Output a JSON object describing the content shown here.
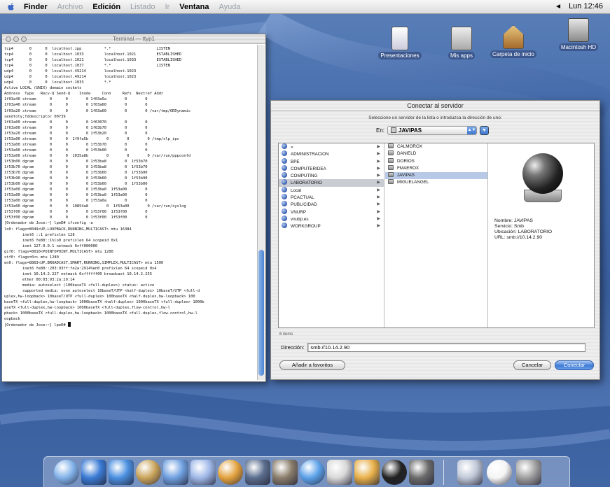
{
  "menubar": {
    "app": "Finder",
    "items": [
      "Archivo",
      "Edición",
      "Listado",
      "Ir",
      "Ventana",
      "Ayuda"
    ],
    "clock": "Lun 12:46"
  },
  "desktop_icons": [
    {
      "label": "Presentaciones",
      "icon": "document-icon"
    },
    {
      "label": "Mis apps",
      "icon": "app-folder-icon"
    },
    {
      "label": "Carpeta de inicio",
      "icon": "home-icon"
    },
    {
      "label": "Macintosh HD",
      "icon": "hard-disk-icon"
    }
  ],
  "terminal": {
    "title": "Terminal — ttyp1",
    "lines": [
      "tcp4       0      0  localhost.ipp          *.*                    LISTEN",
      "tcp4       0      0  localhost.1033         localhost.1021         ESTABLISHED",
      "tcp4       0      0  localhost.1021         localhost.1033         ESTABLISHED",
      "tcp4       0      0  localhost.1037         *.*                    LISTEN",
      "udp4       0      0  localhost.49214        localhost.1023",
      "udp4       0      0  localhost.49214        localhost.1023",
      "udp4       0      0  localhost.1033         *.*",
      "Active LOCAL (UNIX) domain sockets",
      "Address  Type   Recv-Q Send-Q    Inode     Conn     Refs  Nextref Addr",
      "1f03a40 stream      0      0        0 1f03a5a        0        0",
      "1f03a40 stream      0      0        0 1f03a60        0        0",
      "1f03a20 stream      0      0        0 1f03a60        0        0 /var/tmp/ODDynamic",
      "sendtoty;fddescriptor 00739",
      "1f63a00 stream      0      0        0 1f63070        0        0",
      "1f63a00 stream      0      0        0 1f63b70        0        0",
      "1f53a20 stream      0      0        0 1f53b20        0        0",
      "1f53a00 stream      0      0  1f9fa5b        0        0        0 /tmp/slp_ipc",
      "1f53a00 stream      0      0        0 1f53b70        0        0",
      "1f53a00 stream      0      0        0 1f53b00        0        0",
      "1f53a00 stream      0      0  1035a8b        0        0        0 /var/run/pppconfd",
      "1f53b00 dgram       0      0        0 1f53ba8        0  1f53b70",
      "1f53b70 dgram       0      0        0 1f53ba8        0  1f53b70",
      "1f53b70 dgram       0      0        0 1f53b60        0  1f53b90",
      "1f53b90 dgram       0      0        0 1f53b60        0  1f53b90",
      "1f53b00 dgram       0      0        0 1f53b60        0  1f53b00",
      "1f53a00 dgram       0      0        0 1f53ba0  1f53a00        0",
      "1f53a00 dgram       0      0        0 1f53ba0  1f53a00        0",
      "1f53a00 dgram       0      0        0 1f53a0a        0        0",
      "1f53a00 dgram       0      0  10854a8        0  1f53a00        0 /var/run/syslog",
      "1f53f00 dgram       0      0        0 1f53f00  1f53f00        0",
      "1f53f00 dgram       0      0        0 1f53f00  1f53f00        0",
      "[Ordenador de Jose:~] lpeE# ifconfig -a",
      "lo0: flags=8049<UP,LOOPBACK,RUNNING,MULTICAST> mtu 16384",
      "        inet6 ::1 prefixlen 128",
      "        inet6 fe80::1%lo0 prefixlen 64 scopeid 0x1",
      "        inet 127.0.0.1 netmask 0xff000000",
      "gif0: flags=8010<POINTOPOINT,MULTICAST> mtu 1280",
      "stf0: flags=0<> mtu 1280",
      "en0: flags=8863<UP,BROADCAST,SMART,RUNNING,SIMPLEX,MULTICAST> mtu 1500",
      "        inet6 fe80::203:93ff:fe2a:2914%en0 prefixlen 64 scopeid 0x4",
      "        inet 10.14.2.227 netmask 0xffffff00 broadcast 10.14.2.255",
      "        ether 00:03:93:2a:29:14",
      "        media: autoselect (100baseTX <full-duplex>) status: active",
      "        supported media: none autoselect 10baseT/UTP <half-duplex> 10baseT/UTP <full-d",
      "uplex,hw-loopback> 10baseT/UTP <full-duplex> 100baseTX <half-duplex,hw-loopback> 100",
      "baseTX <full-duplex,hw-loopback> 1000baseTX <half-duplex> 1000baseTX <full-duplex> 1000b",
      "aseTX <full-duplex,hw-loopback> 1000baseTX <full-duplex,flow-control,hw-l",
      "pback> 1000baseTX <full-duplex,hw-loopback> 1000baseTX <full-duplex,flow-control,hw-l",
      "oopback",
      "[Ordenador de Jose:~] lpeE# "
    ]
  },
  "dialog": {
    "title": "Conectar al servidor",
    "instructions": "Seleccione un servidor de la lista o introduzca la dirección de uno:",
    "en_label": "En:",
    "en_value": "JAVIPAS",
    "column1": [
      {
        "label": "«",
        "chev": true
      },
      {
        "label": "ADMINISTRACION",
        "chev": true
      },
      {
        "label": "BPE",
        "chev": true
      },
      {
        "label": "COMPUTERIDEA",
        "chev": true
      },
      {
        "label": "COMPUTING",
        "chev": true
      },
      {
        "label": "LABORATORIO",
        "chev": true,
        "selected": true
      },
      {
        "label": "Local",
        "chev": true
      },
      {
        "label": "PCACTUAL",
        "chev": true
      },
      {
        "label": "PUBLICIDAD",
        "chev": true
      },
      {
        "label": "VNURP",
        "chev": true
      },
      {
        "label": "vnubp.es",
        "chev": true
      },
      {
        "label": "WORKGROUP",
        "chev": true
      }
    ],
    "column2": [
      {
        "label": "CALMOROX"
      },
      {
        "label": "DANIELD"
      },
      {
        "label": "DORIOS"
      },
      {
        "label": "FMAEROX"
      },
      {
        "label": "JAVIPAS",
        "selected": true
      },
      {
        "label": "MIGUELANGEL"
      }
    ],
    "info": {
      "nombre": "Nombre: JAVIPAS",
      "servicio": "Servicio: Smb",
      "ubicacion": "Ubicación: LABORATORIO",
      "url": "URL: smb://10.14.2.90"
    },
    "count": "6 items",
    "address_label": "Dirección:",
    "address_value": "smb://10.14.2.90",
    "favorites_button": "Añadir a favoritos",
    "cancel_button": "Cancelar",
    "connect_button": "Conectar"
  },
  "dock_items": [
    "finder-icon",
    "mail-icon",
    "ie-icon",
    "address-book-icon",
    "ichat-icon",
    "itunes-icon",
    "iphoto-icon",
    "imovie-icon",
    "sherlock-icon",
    "quicktime-icon",
    "apple-icon",
    "itunes-disc-icon",
    "terminal-icon",
    "network-icon",
    "mail-at-icon",
    "document-icon",
    "trash-icon"
  ]
}
